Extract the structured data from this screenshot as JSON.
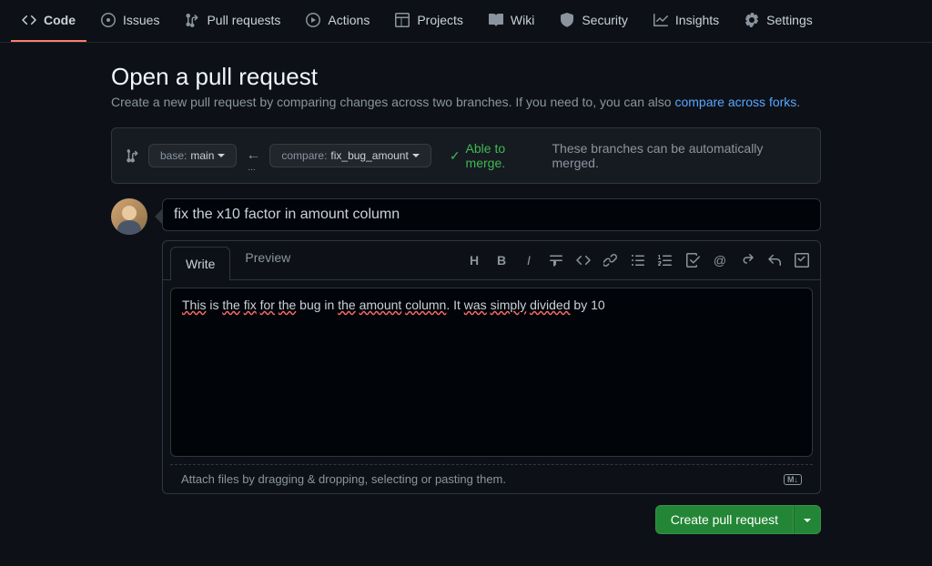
{
  "nav": [
    {
      "label": "Code",
      "icon": "code"
    },
    {
      "label": "Issues",
      "icon": "dot-circle"
    },
    {
      "label": "Pull requests",
      "icon": "git-pr"
    },
    {
      "label": "Actions",
      "icon": "play-circle"
    },
    {
      "label": "Projects",
      "icon": "table"
    },
    {
      "label": "Wiki",
      "icon": "book"
    },
    {
      "label": "Security",
      "icon": "shield"
    },
    {
      "label": "Insights",
      "icon": "graph"
    },
    {
      "label": "Settings",
      "icon": "gear"
    }
  ],
  "page": {
    "title": "Open a pull request",
    "subtitle_prefix": "Create a new pull request by comparing changes across two branches. If you need to, you can also ",
    "subtitle_link": "compare across forks",
    "subtitle_suffix": "."
  },
  "compare": {
    "base_label": "base:",
    "base_value": "main",
    "compare_label": "compare:",
    "compare_value": "fix_bug_amount",
    "able_text": "Able to merge.",
    "merge_desc": "These branches can be automatically merged."
  },
  "form": {
    "title_value": "fix the x10 factor in amount column",
    "tabs": {
      "write": "Write",
      "preview": "Preview"
    },
    "description_value": "This is the fix for the bug in the amount column. It was simply divided by 10",
    "attach_text": "Attach files by dragging & dropping, selecting or pasting them.",
    "submit_label": "Create pull request"
  }
}
